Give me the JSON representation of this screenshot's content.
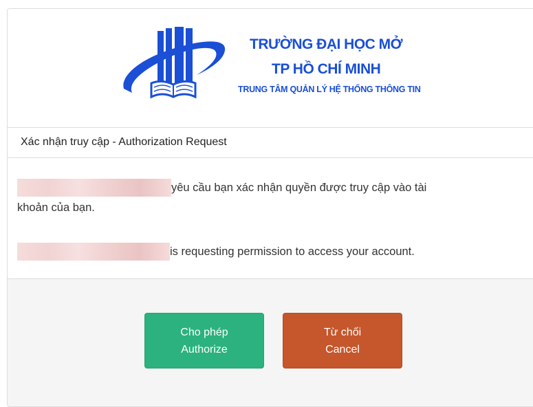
{
  "logo": {
    "line1": "TRƯỜNG ĐẠI HỌC MỞ",
    "line2": "TP HỒ CHÍ MINH",
    "line3": "TRUNG TÂM QUẢN LÝ HỆ THỐNG THÔNG TIN",
    "color": "#1a4fd6"
  },
  "header": {
    "title": "Xác nhận truy cập - Authorization Request"
  },
  "body": {
    "vi_line1": "yêu cầu bạn xác nhận quyền được truy cập vào tài",
    "vi_line2": "khoản của bạn.",
    "en_line": "is requesting permission to access your account."
  },
  "buttons": {
    "authorize_vi": "Cho phép",
    "authorize_en": "Authorize",
    "cancel_vi": "Từ chối",
    "cancel_en": "Cancel",
    "authorize_color": "#2bb27e",
    "cancel_color": "#c6562b"
  }
}
